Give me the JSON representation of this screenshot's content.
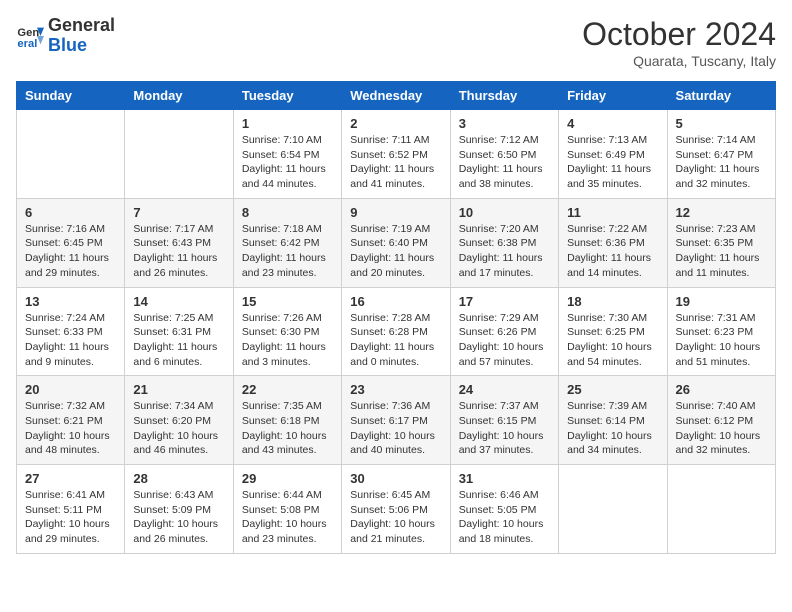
{
  "header": {
    "logo_line1": "General",
    "logo_line2": "Blue",
    "month": "October 2024",
    "location": "Quarata, Tuscany, Italy"
  },
  "weekdays": [
    "Sunday",
    "Monday",
    "Tuesday",
    "Wednesday",
    "Thursday",
    "Friday",
    "Saturday"
  ],
  "weeks": [
    [
      {
        "day": "",
        "sunrise": "",
        "sunset": "",
        "daylight": ""
      },
      {
        "day": "",
        "sunrise": "",
        "sunset": "",
        "daylight": ""
      },
      {
        "day": "1",
        "sunrise": "Sunrise: 7:10 AM",
        "sunset": "Sunset: 6:54 PM",
        "daylight": "Daylight: 11 hours and 44 minutes."
      },
      {
        "day": "2",
        "sunrise": "Sunrise: 7:11 AM",
        "sunset": "Sunset: 6:52 PM",
        "daylight": "Daylight: 11 hours and 41 minutes."
      },
      {
        "day": "3",
        "sunrise": "Sunrise: 7:12 AM",
        "sunset": "Sunset: 6:50 PM",
        "daylight": "Daylight: 11 hours and 38 minutes."
      },
      {
        "day": "4",
        "sunrise": "Sunrise: 7:13 AM",
        "sunset": "Sunset: 6:49 PM",
        "daylight": "Daylight: 11 hours and 35 minutes."
      },
      {
        "day": "5",
        "sunrise": "Sunrise: 7:14 AM",
        "sunset": "Sunset: 6:47 PM",
        "daylight": "Daylight: 11 hours and 32 minutes."
      }
    ],
    [
      {
        "day": "6",
        "sunrise": "Sunrise: 7:16 AM",
        "sunset": "Sunset: 6:45 PM",
        "daylight": "Daylight: 11 hours and 29 minutes."
      },
      {
        "day": "7",
        "sunrise": "Sunrise: 7:17 AM",
        "sunset": "Sunset: 6:43 PM",
        "daylight": "Daylight: 11 hours and 26 minutes."
      },
      {
        "day": "8",
        "sunrise": "Sunrise: 7:18 AM",
        "sunset": "Sunset: 6:42 PM",
        "daylight": "Daylight: 11 hours and 23 minutes."
      },
      {
        "day": "9",
        "sunrise": "Sunrise: 7:19 AM",
        "sunset": "Sunset: 6:40 PM",
        "daylight": "Daylight: 11 hours and 20 minutes."
      },
      {
        "day": "10",
        "sunrise": "Sunrise: 7:20 AM",
        "sunset": "Sunset: 6:38 PM",
        "daylight": "Daylight: 11 hours and 17 minutes."
      },
      {
        "day": "11",
        "sunrise": "Sunrise: 7:22 AM",
        "sunset": "Sunset: 6:36 PM",
        "daylight": "Daylight: 11 hours and 14 minutes."
      },
      {
        "day": "12",
        "sunrise": "Sunrise: 7:23 AM",
        "sunset": "Sunset: 6:35 PM",
        "daylight": "Daylight: 11 hours and 11 minutes."
      }
    ],
    [
      {
        "day": "13",
        "sunrise": "Sunrise: 7:24 AM",
        "sunset": "Sunset: 6:33 PM",
        "daylight": "Daylight: 11 hours and 9 minutes."
      },
      {
        "day": "14",
        "sunrise": "Sunrise: 7:25 AM",
        "sunset": "Sunset: 6:31 PM",
        "daylight": "Daylight: 11 hours and 6 minutes."
      },
      {
        "day": "15",
        "sunrise": "Sunrise: 7:26 AM",
        "sunset": "Sunset: 6:30 PM",
        "daylight": "Daylight: 11 hours and 3 minutes."
      },
      {
        "day": "16",
        "sunrise": "Sunrise: 7:28 AM",
        "sunset": "Sunset: 6:28 PM",
        "daylight": "Daylight: 11 hours and 0 minutes."
      },
      {
        "day": "17",
        "sunrise": "Sunrise: 7:29 AM",
        "sunset": "Sunset: 6:26 PM",
        "daylight": "Daylight: 10 hours and 57 minutes."
      },
      {
        "day": "18",
        "sunrise": "Sunrise: 7:30 AM",
        "sunset": "Sunset: 6:25 PM",
        "daylight": "Daylight: 10 hours and 54 minutes."
      },
      {
        "day": "19",
        "sunrise": "Sunrise: 7:31 AM",
        "sunset": "Sunset: 6:23 PM",
        "daylight": "Daylight: 10 hours and 51 minutes."
      }
    ],
    [
      {
        "day": "20",
        "sunrise": "Sunrise: 7:32 AM",
        "sunset": "Sunset: 6:21 PM",
        "daylight": "Daylight: 10 hours and 48 minutes."
      },
      {
        "day": "21",
        "sunrise": "Sunrise: 7:34 AM",
        "sunset": "Sunset: 6:20 PM",
        "daylight": "Daylight: 10 hours and 46 minutes."
      },
      {
        "day": "22",
        "sunrise": "Sunrise: 7:35 AM",
        "sunset": "Sunset: 6:18 PM",
        "daylight": "Daylight: 10 hours and 43 minutes."
      },
      {
        "day": "23",
        "sunrise": "Sunrise: 7:36 AM",
        "sunset": "Sunset: 6:17 PM",
        "daylight": "Daylight: 10 hours and 40 minutes."
      },
      {
        "day": "24",
        "sunrise": "Sunrise: 7:37 AM",
        "sunset": "Sunset: 6:15 PM",
        "daylight": "Daylight: 10 hours and 37 minutes."
      },
      {
        "day": "25",
        "sunrise": "Sunrise: 7:39 AM",
        "sunset": "Sunset: 6:14 PM",
        "daylight": "Daylight: 10 hours and 34 minutes."
      },
      {
        "day": "26",
        "sunrise": "Sunrise: 7:40 AM",
        "sunset": "Sunset: 6:12 PM",
        "daylight": "Daylight: 10 hours and 32 minutes."
      }
    ],
    [
      {
        "day": "27",
        "sunrise": "Sunrise: 6:41 AM",
        "sunset": "Sunset: 5:11 PM",
        "daylight": "Daylight: 10 hours and 29 minutes."
      },
      {
        "day": "28",
        "sunrise": "Sunrise: 6:43 AM",
        "sunset": "Sunset: 5:09 PM",
        "daylight": "Daylight: 10 hours and 26 minutes."
      },
      {
        "day": "29",
        "sunrise": "Sunrise: 6:44 AM",
        "sunset": "Sunset: 5:08 PM",
        "daylight": "Daylight: 10 hours and 23 minutes."
      },
      {
        "day": "30",
        "sunrise": "Sunrise: 6:45 AM",
        "sunset": "Sunset: 5:06 PM",
        "daylight": "Daylight: 10 hours and 21 minutes."
      },
      {
        "day": "31",
        "sunrise": "Sunrise: 6:46 AM",
        "sunset": "Sunset: 5:05 PM",
        "daylight": "Daylight: 10 hours and 18 minutes."
      },
      {
        "day": "",
        "sunrise": "",
        "sunset": "",
        "daylight": ""
      },
      {
        "day": "",
        "sunrise": "",
        "sunset": "",
        "daylight": ""
      }
    ]
  ]
}
